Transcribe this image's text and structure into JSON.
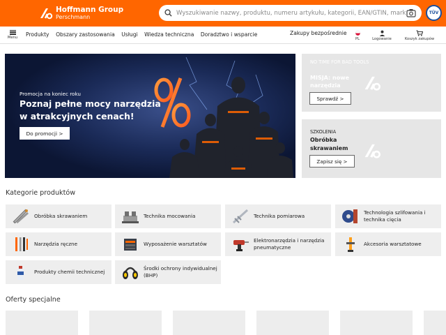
{
  "header": {
    "logo_line1": "Hoffmann Group",
    "logo_line2": "Perschmann",
    "search_placeholder": "Wyszukiwanie nazwy, produktu, numeru artykułu, kategorii, EAN/GTIN, marki...",
    "certificate_label": "TÜV",
    "accent_color": "#ff6600"
  },
  "nav": {
    "menu_label": "Menu",
    "links": [
      "Produkty",
      "Obszary zastosowania",
      "Usługi",
      "Wiedza techniczna",
      "Doradztwo i wsparcie"
    ],
    "direct_purchase": "Zakupy bezpośrednie",
    "language": "PL",
    "login": "Logowanie",
    "cart": "Koszyk zakupów"
  },
  "hero": {
    "small": "Promocja na koniec roku",
    "title_line1": "Poznaj pełne mocy narzędzia",
    "title_line2": "w atrakcyjnych cenach!",
    "button": "Do promocji >"
  },
  "side_cards": [
    {
      "small": "NO TIME FOR BAD TOOLS",
      "title_line1": "MISJA: nowe",
      "title_line2": "narzędzia",
      "button": "Sprawdź >"
    },
    {
      "small": "SZKOLENIA",
      "title_line1": "Obróbka",
      "title_line2": "skrawaniem",
      "button": "Zapisz się >"
    }
  ],
  "categories_title": "Kategorie produktów",
  "categories": [
    {
      "line1": "Obróbka skrawaniem",
      "line2": "",
      "icon": "drill-bit-icon"
    },
    {
      "line1": "Technika mocowania",
      "line2": "",
      "icon": "vise-icon"
    },
    {
      "line1": "Technika pomiarowa",
      "line2": "",
      "icon": "caliper-icon"
    },
    {
      "line1": "Technologia szlifowania i",
      "line2": "technika cięcia",
      "icon": "grinding-disc-icon"
    },
    {
      "line1": "Narzędzia ręczne",
      "line2": "",
      "icon": "hand-tools-icon"
    },
    {
      "line1": "Wyposażenie warsztatów",
      "line2": "",
      "icon": "workbench-icon"
    },
    {
      "line1": "Elektronarzędzia i narzędzia",
      "line2": "pneumatyczne",
      "icon": "power-drill-icon"
    },
    {
      "line1": "Akcesoria warsztatowe",
      "line2": "",
      "icon": "accessories-icon"
    },
    {
      "line1": "Produkty chemii technicznej",
      "line2": "",
      "icon": "spray-can-icon"
    },
    {
      "line1": "Środki ochrony indywidualnej",
      "line2": "(BHP)",
      "icon": "ear-protection-icon"
    }
  ],
  "offers_title": "Oferty specjalne"
}
